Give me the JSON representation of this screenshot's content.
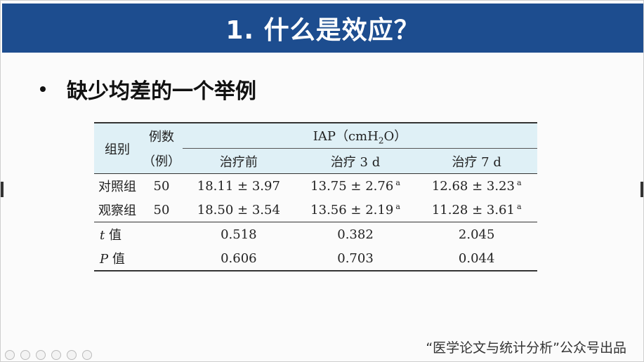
{
  "slide": {
    "title": "1. 什么是效应？",
    "bullet": "缺少均差的一个举例",
    "footer": "“医学论文与统计分析”公众号出品"
  },
  "table": {
    "header": {
      "group": "组别",
      "count_line1": "例数",
      "count_line2": "（例）",
      "iap_prefix": "IAP（cmH",
      "iap_sub": "2",
      "iap_suffix": "O）",
      "before": "治疗前",
      "day3": "治疗 3 d",
      "day7": "治疗 7 d"
    },
    "rows": [
      {
        "group": "对照组",
        "n": "50",
        "before": "18.11 ± 3.97",
        "day3": "13.75 ± 2.76",
        "day3_sup": "a",
        "day7": "12.68 ± 3.23",
        "day7_sup": "a"
      },
      {
        "group": "观察组",
        "n": "50",
        "before": "18.50 ± 3.54",
        "day3": "13.56 ± 2.19",
        "day3_sup": "a",
        "day7": "11.28 ± 3.61",
        "day7_sup": "a"
      }
    ],
    "stats": [
      {
        "label_var": "t",
        "label_rest": " 值",
        "before": "0.518",
        "day3": "0.382",
        "day7": "2.045"
      },
      {
        "label_var": "P",
        "label_rest": " 值",
        "before": "0.606",
        "day3": "0.703",
        "day7": "0.044"
      }
    ]
  },
  "colors": {
    "title_bar": "#1d4d8f",
    "header_bg": "#dff0f6"
  }
}
